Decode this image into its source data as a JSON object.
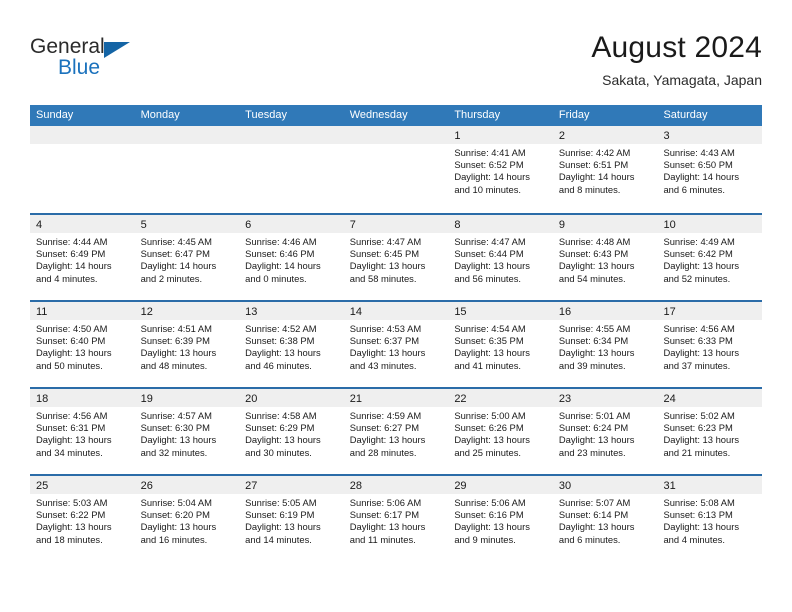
{
  "brand": {
    "name_part1": "General",
    "name_part2": "Blue",
    "logo_icon": "triangle-logo-icon"
  },
  "header": {
    "title": "August 2024",
    "subtitle": "Sakata, Yamagata, Japan"
  },
  "weekdays": [
    "Sunday",
    "Monday",
    "Tuesday",
    "Wednesday",
    "Thursday",
    "Friday",
    "Saturday"
  ],
  "colors": {
    "header_blue": "#3079b8",
    "row_divider_blue": "#2b6ca8",
    "daynum_band": "#efefef",
    "brand_blue": "#1b72bd",
    "logo_blue": "#1464a5"
  },
  "weeks": [
    [
      {
        "day": "",
        "sunrise": "",
        "sunset": "",
        "daylight1": "",
        "daylight2": ""
      },
      {
        "day": "",
        "sunrise": "",
        "sunset": "",
        "daylight1": "",
        "daylight2": ""
      },
      {
        "day": "",
        "sunrise": "",
        "sunset": "",
        "daylight1": "",
        "daylight2": ""
      },
      {
        "day": "",
        "sunrise": "",
        "sunset": "",
        "daylight1": "",
        "daylight2": ""
      },
      {
        "day": "1",
        "sunrise": "Sunrise: 4:41 AM",
        "sunset": "Sunset: 6:52 PM",
        "daylight1": "Daylight: 14 hours",
        "daylight2": "and 10 minutes."
      },
      {
        "day": "2",
        "sunrise": "Sunrise: 4:42 AM",
        "sunset": "Sunset: 6:51 PM",
        "daylight1": "Daylight: 14 hours",
        "daylight2": "and 8 minutes."
      },
      {
        "day": "3",
        "sunrise": "Sunrise: 4:43 AM",
        "sunset": "Sunset: 6:50 PM",
        "daylight1": "Daylight: 14 hours",
        "daylight2": "and 6 minutes."
      }
    ],
    [
      {
        "day": "4",
        "sunrise": "Sunrise: 4:44 AM",
        "sunset": "Sunset: 6:49 PM",
        "daylight1": "Daylight: 14 hours",
        "daylight2": "and 4 minutes."
      },
      {
        "day": "5",
        "sunrise": "Sunrise: 4:45 AM",
        "sunset": "Sunset: 6:47 PM",
        "daylight1": "Daylight: 14 hours",
        "daylight2": "and 2 minutes."
      },
      {
        "day": "6",
        "sunrise": "Sunrise: 4:46 AM",
        "sunset": "Sunset: 6:46 PM",
        "daylight1": "Daylight: 14 hours",
        "daylight2": "and 0 minutes."
      },
      {
        "day": "7",
        "sunrise": "Sunrise: 4:47 AM",
        "sunset": "Sunset: 6:45 PM",
        "daylight1": "Daylight: 13 hours",
        "daylight2": "and 58 minutes."
      },
      {
        "day": "8",
        "sunrise": "Sunrise: 4:47 AM",
        "sunset": "Sunset: 6:44 PM",
        "daylight1": "Daylight: 13 hours",
        "daylight2": "and 56 minutes."
      },
      {
        "day": "9",
        "sunrise": "Sunrise: 4:48 AM",
        "sunset": "Sunset: 6:43 PM",
        "daylight1": "Daylight: 13 hours",
        "daylight2": "and 54 minutes."
      },
      {
        "day": "10",
        "sunrise": "Sunrise: 4:49 AM",
        "sunset": "Sunset: 6:42 PM",
        "daylight1": "Daylight: 13 hours",
        "daylight2": "and 52 minutes."
      }
    ],
    [
      {
        "day": "11",
        "sunrise": "Sunrise: 4:50 AM",
        "sunset": "Sunset: 6:40 PM",
        "daylight1": "Daylight: 13 hours",
        "daylight2": "and 50 minutes."
      },
      {
        "day": "12",
        "sunrise": "Sunrise: 4:51 AM",
        "sunset": "Sunset: 6:39 PM",
        "daylight1": "Daylight: 13 hours",
        "daylight2": "and 48 minutes."
      },
      {
        "day": "13",
        "sunrise": "Sunrise: 4:52 AM",
        "sunset": "Sunset: 6:38 PM",
        "daylight1": "Daylight: 13 hours",
        "daylight2": "and 46 minutes."
      },
      {
        "day": "14",
        "sunrise": "Sunrise: 4:53 AM",
        "sunset": "Sunset: 6:37 PM",
        "daylight1": "Daylight: 13 hours",
        "daylight2": "and 43 minutes."
      },
      {
        "day": "15",
        "sunrise": "Sunrise: 4:54 AM",
        "sunset": "Sunset: 6:35 PM",
        "daylight1": "Daylight: 13 hours",
        "daylight2": "and 41 minutes."
      },
      {
        "day": "16",
        "sunrise": "Sunrise: 4:55 AM",
        "sunset": "Sunset: 6:34 PM",
        "daylight1": "Daylight: 13 hours",
        "daylight2": "and 39 minutes."
      },
      {
        "day": "17",
        "sunrise": "Sunrise: 4:56 AM",
        "sunset": "Sunset: 6:33 PM",
        "daylight1": "Daylight: 13 hours",
        "daylight2": "and 37 minutes."
      }
    ],
    [
      {
        "day": "18",
        "sunrise": "Sunrise: 4:56 AM",
        "sunset": "Sunset: 6:31 PM",
        "daylight1": "Daylight: 13 hours",
        "daylight2": "and 34 minutes."
      },
      {
        "day": "19",
        "sunrise": "Sunrise: 4:57 AM",
        "sunset": "Sunset: 6:30 PM",
        "daylight1": "Daylight: 13 hours",
        "daylight2": "and 32 minutes."
      },
      {
        "day": "20",
        "sunrise": "Sunrise: 4:58 AM",
        "sunset": "Sunset: 6:29 PM",
        "daylight1": "Daylight: 13 hours",
        "daylight2": "and 30 minutes."
      },
      {
        "day": "21",
        "sunrise": "Sunrise: 4:59 AM",
        "sunset": "Sunset: 6:27 PM",
        "daylight1": "Daylight: 13 hours",
        "daylight2": "and 28 minutes."
      },
      {
        "day": "22",
        "sunrise": "Sunrise: 5:00 AM",
        "sunset": "Sunset: 6:26 PM",
        "daylight1": "Daylight: 13 hours",
        "daylight2": "and 25 minutes."
      },
      {
        "day": "23",
        "sunrise": "Sunrise: 5:01 AM",
        "sunset": "Sunset: 6:24 PM",
        "daylight1": "Daylight: 13 hours",
        "daylight2": "and 23 minutes."
      },
      {
        "day": "24",
        "sunrise": "Sunrise: 5:02 AM",
        "sunset": "Sunset: 6:23 PM",
        "daylight1": "Daylight: 13 hours",
        "daylight2": "and 21 minutes."
      }
    ],
    [
      {
        "day": "25",
        "sunrise": "Sunrise: 5:03 AM",
        "sunset": "Sunset: 6:22 PM",
        "daylight1": "Daylight: 13 hours",
        "daylight2": "and 18 minutes."
      },
      {
        "day": "26",
        "sunrise": "Sunrise: 5:04 AM",
        "sunset": "Sunset: 6:20 PM",
        "daylight1": "Daylight: 13 hours",
        "daylight2": "and 16 minutes."
      },
      {
        "day": "27",
        "sunrise": "Sunrise: 5:05 AM",
        "sunset": "Sunset: 6:19 PM",
        "daylight1": "Daylight: 13 hours",
        "daylight2": "and 14 minutes."
      },
      {
        "day": "28",
        "sunrise": "Sunrise: 5:06 AM",
        "sunset": "Sunset: 6:17 PM",
        "daylight1": "Daylight: 13 hours",
        "daylight2": "and 11 minutes."
      },
      {
        "day": "29",
        "sunrise": "Sunrise: 5:06 AM",
        "sunset": "Sunset: 6:16 PM",
        "daylight1": "Daylight: 13 hours",
        "daylight2": "and 9 minutes."
      },
      {
        "day": "30",
        "sunrise": "Sunrise: 5:07 AM",
        "sunset": "Sunset: 6:14 PM",
        "daylight1": "Daylight: 13 hours",
        "daylight2": "and 6 minutes."
      },
      {
        "day": "31",
        "sunrise": "Sunrise: 5:08 AM",
        "sunset": "Sunset: 6:13 PM",
        "daylight1": "Daylight: 13 hours",
        "daylight2": "and 4 minutes."
      }
    ]
  ]
}
